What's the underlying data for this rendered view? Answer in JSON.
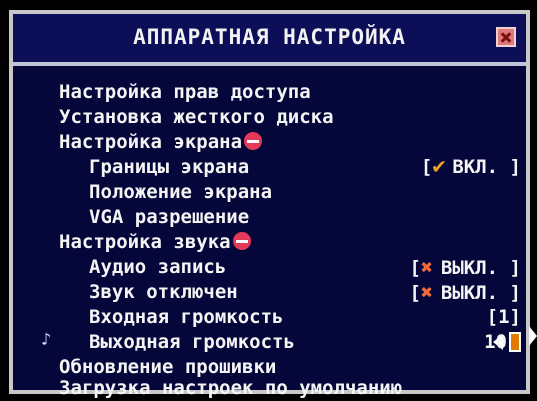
{
  "window": {
    "title": "АППАРАТНАЯ НАСТРОЙКА"
  },
  "menu": {
    "items": [
      {
        "label": "Настройка прав доступа"
      },
      {
        "label": "Установка жесткого диска"
      },
      {
        "label": "Настройка экрана"
      },
      {
        "label": "Границы экрана",
        "value": "ВКЛ. ]",
        "value_prefix": "[",
        "state_icon": "checkmark-icon"
      },
      {
        "label": "Положение экрана"
      },
      {
        "label": "VGA разрешение"
      },
      {
        "label": "Настройка звука"
      },
      {
        "label": "Аудио запись",
        "value": "ВЫКЛ. ]",
        "value_prefix": "[",
        "state_icon": "x-icon"
      },
      {
        "label": "Звук отключен",
        "value": "ВЫКЛ. ]",
        "value_prefix": "[",
        "state_icon": "x-icon"
      },
      {
        "label": "Входная громкость",
        "value": "[1]"
      },
      {
        "label": "Выходная громкость",
        "value": "10"
      },
      {
        "label": "Обновление прошивки"
      },
      {
        "label": "Загрузка настроек по умолчанию"
      }
    ]
  },
  "colors": {
    "background": "#05063a",
    "title_bar": "#0c0f58",
    "accent": "#e07a00",
    "collapse_badge": "#e33a5a"
  }
}
